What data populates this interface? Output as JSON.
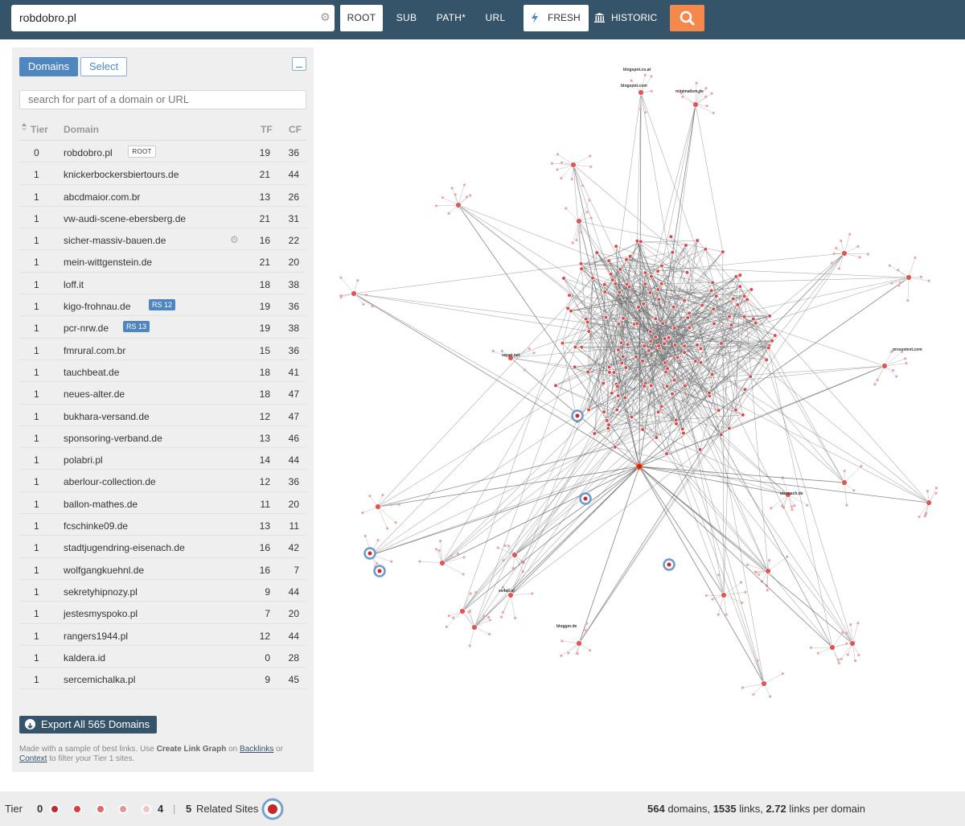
{
  "search": {
    "value": "robdobro.pl"
  },
  "modes": {
    "root": "ROOT",
    "sub": "SUB",
    "path": "PATH*",
    "url": "URL"
  },
  "freshness": {
    "fresh": "FRESH",
    "historic": "HISTORIC"
  },
  "colors": {
    "topbar": "#35546a",
    "accent": "#4f86c0",
    "go": "#f5884b",
    "tier0": "#c62828",
    "tier1": "#e05555"
  },
  "panel": {
    "tabs": {
      "domains": "Domains",
      "select": "Select"
    },
    "filter_placeholder": "search for part of a domain or URL",
    "columns": {
      "tier": "Tier",
      "domain": "Domain",
      "tf": "TF",
      "cf": "CF"
    },
    "rows": [
      {
        "tier": "0",
        "domain": "robdobro.pl",
        "badge": "ROOT",
        "tf": "19",
        "cf": "36"
      },
      {
        "tier": "1",
        "domain": "knickerbockersbiertours.de",
        "tf": "21",
        "cf": "44"
      },
      {
        "tier": "1",
        "domain": "abcdmaior.com.br",
        "tf": "13",
        "cf": "26"
      },
      {
        "tier": "1",
        "domain": "vw-audi-scene-ebersberg.de",
        "tf": "21",
        "cf": "31"
      },
      {
        "tier": "1",
        "domain": "sicher-massiv-bauen.de",
        "gear": true,
        "tf": "16",
        "cf": "22"
      },
      {
        "tier": "1",
        "domain": "mein-wittgenstein.de",
        "tf": "21",
        "cf": "20"
      },
      {
        "tier": "1",
        "domain": "loff.it",
        "tf": "18",
        "cf": "38"
      },
      {
        "tier": "1",
        "domain": "kigo-frohnau.de",
        "rs": "RS 12",
        "tf": "19",
        "cf": "36"
      },
      {
        "tier": "1",
        "domain": "pcr-nrw.de",
        "rs": "RS 13",
        "tf": "19",
        "cf": "38"
      },
      {
        "tier": "1",
        "domain": "fmrural.com.br",
        "tf": "15",
        "cf": "36"
      },
      {
        "tier": "1",
        "domain": "tauchbeat.de",
        "tf": "18",
        "cf": "41"
      },
      {
        "tier": "1",
        "domain": "neues-alter.de",
        "tf": "18",
        "cf": "47"
      },
      {
        "tier": "1",
        "domain": "bukhara-versand.de",
        "tf": "12",
        "cf": "47"
      },
      {
        "tier": "1",
        "domain": "sponsoring-verband.de",
        "tf": "13",
        "cf": "46"
      },
      {
        "tier": "1",
        "domain": "polabri.pl",
        "tf": "14",
        "cf": "44"
      },
      {
        "tier": "1",
        "domain": "aberlour-collection.de",
        "tf": "12",
        "cf": "36"
      },
      {
        "tier": "1",
        "domain": "ballon-mathes.de",
        "tf": "11",
        "cf": "20"
      },
      {
        "tier": "1",
        "domain": "fcschinke09.de",
        "tf": "13",
        "cf": "11"
      },
      {
        "tier": "1",
        "domain": "stadtjugendring-eisenach.de",
        "tf": "16",
        "cf": "42"
      },
      {
        "tier": "1",
        "domain": "wolfgangkuehnl.de",
        "tf": "16",
        "cf": "7"
      },
      {
        "tier": "1",
        "domain": "sekretyhipnozy.pl",
        "tf": "9",
        "cf": "44"
      },
      {
        "tier": "1",
        "domain": "jestesmyspoko.pl",
        "tf": "7",
        "cf": "20"
      },
      {
        "tier": "1",
        "domain": "rangers1944.pl",
        "tf": "12",
        "cf": "44"
      },
      {
        "tier": "1",
        "domain": "kaldera.id",
        "tf": "0",
        "cf": "28"
      },
      {
        "tier": "1",
        "domain": "sercemichalka.pl",
        "tf": "9",
        "cf": "45"
      }
    ],
    "export_label": "Export All 565 Domains",
    "note": {
      "a": "Made with a sample of best links. Use ",
      "b": "Create Link Graph",
      "c": " on ",
      "d": "Backlinks",
      "e": " or",
      "f": "Context",
      "g": " to filter your Tier 1 sites."
    }
  },
  "graph_labels": [
    {
      "id": "blogspot",
      "text": "blogspot.com"
    },
    {
      "id": "blogspot-co",
      "text": "blogspot.co.at"
    },
    {
      "id": "squat",
      "text": "squat.net"
    },
    {
      "id": "pressetext",
      "text": "pressetext.com"
    },
    {
      "id": "ixs",
      "text": "xs4all.nl"
    },
    {
      "id": "eisenach",
      "text": "eisenach.de"
    },
    {
      "id": "blogger",
      "text": "blogger.de"
    },
    {
      "id": "minimalism",
      "text": "minimalism.de"
    }
  ],
  "footer": {
    "tier_label": "Tier",
    "tier_start": "0",
    "tier_end": "4",
    "sep": "|",
    "related_count": "5",
    "related_label": "Related Sites",
    "domains": "564",
    "domains_label": " domains, ",
    "links": "1535",
    "links_label": " links, ",
    "lpd": "2.72",
    "lpd_label": " links per domain"
  }
}
